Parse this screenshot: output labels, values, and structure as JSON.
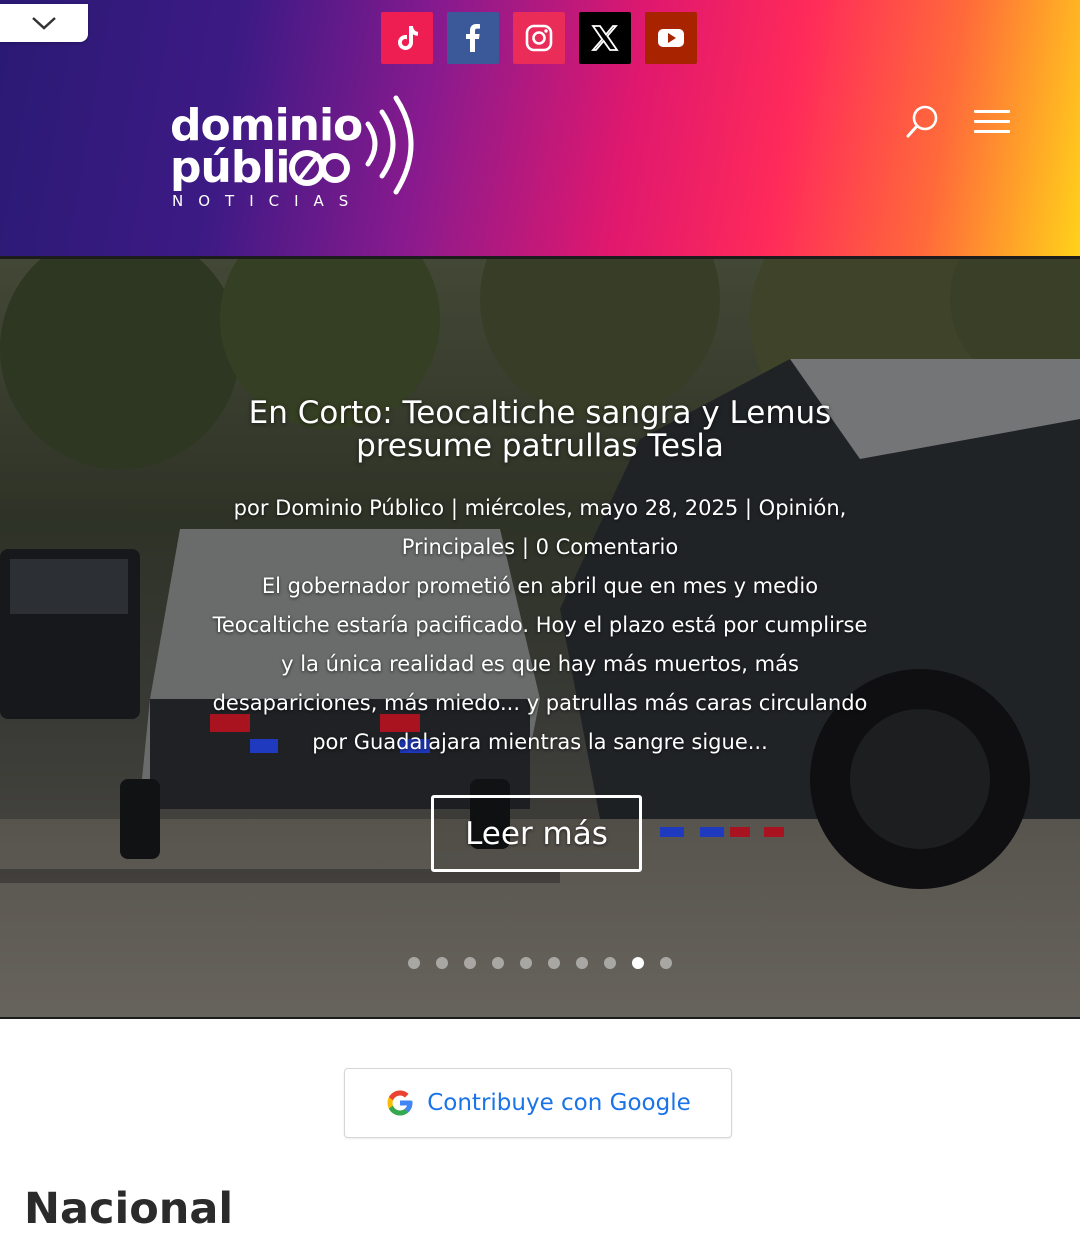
{
  "header": {
    "social_links": [
      {
        "name": "tiktok",
        "color": "#ee1d52",
        "icon": "tiktok-icon"
      },
      {
        "name": "facebook",
        "color": "#3b5998",
        "icon": "facebook-icon"
      },
      {
        "name": "instagram",
        "color": "#ea2c59",
        "icon": "instagram-icon"
      },
      {
        "name": "x",
        "color": "#000000",
        "icon": "x-icon"
      },
      {
        "name": "youtube",
        "color": "#a82400",
        "icon": "youtube-icon"
      }
    ],
    "logo": {
      "line1": "dominio",
      "line2": "públi",
      "line3": "NOTICIAS"
    }
  },
  "hero": {
    "title": "En Corto: Teocaltiche sangra y Lemus presume patrullas Tesla",
    "meta": {
      "prefix": "por",
      "author": "Dominio Público",
      "sep1": "|",
      "date": "miércoles, mayo 28, 2025",
      "sep2": "|",
      "category1": "Opinión,",
      "category2": "Principales",
      "sep3": "|",
      "comments": "0 Comentario"
    },
    "excerpt": "El gobernador prometió en abril que en mes y medio Teocaltiche estaría pacificado. Hoy el plazo está por cumplirse y la única realidad es que hay más muertos, más desapariciones, más miedo... y patrullas más caras circulando por Guadalajara mientras la sangre sigue...",
    "read_more": "Leer más",
    "slide_count": 10,
    "active_slide": 9
  },
  "contribute": {
    "label": "Contribuye con Google"
  },
  "section": {
    "title": "Nacional"
  }
}
